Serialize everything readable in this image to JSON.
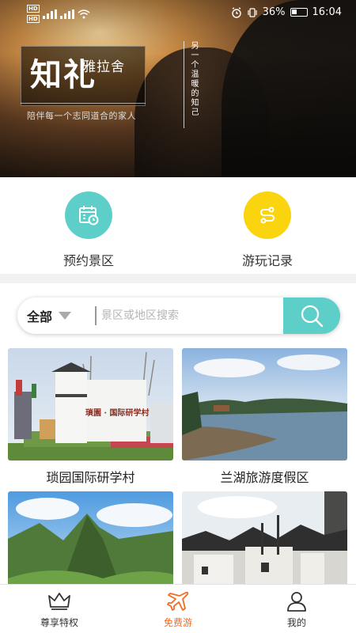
{
  "status_bar": {
    "battery": "36%",
    "time": "16:04",
    "network_badge": "HD"
  },
  "hero": {
    "brand_main": "知礼",
    "brand_sub": "雅拉舍",
    "slogan": "陪伴每一个志同道合的家人",
    "vertical_text": "另一个温暖的知己"
  },
  "quick_actions": [
    {
      "label": "预约景区",
      "icon": "calendar-icon",
      "color": "#5ecfc8"
    },
    {
      "label": "游玩记录",
      "icon": "route-icon",
      "color": "#f9d40f"
    }
  ],
  "search": {
    "filter_label": "全部",
    "placeholder": "景区或地区搜索",
    "accent": "#5ecfc8"
  },
  "cards": [
    {
      "name": "琐园国际研学村",
      "sign_text": "瑣園 · 国际研学村"
    },
    {
      "name": "兰湖旅游度假区"
    },
    {
      "name": ""
    },
    {
      "name": ""
    }
  ],
  "tabs": [
    {
      "label": "尊享特权",
      "icon": "crown-icon",
      "active": false
    },
    {
      "label": "免费游",
      "icon": "airplane-icon",
      "active": true
    },
    {
      "label": "我的",
      "icon": "user-icon",
      "active": false
    }
  ],
  "colors": {
    "active_tab": "#f36b23",
    "teal": "#5ecfc8",
    "yellow": "#f9d40f"
  }
}
